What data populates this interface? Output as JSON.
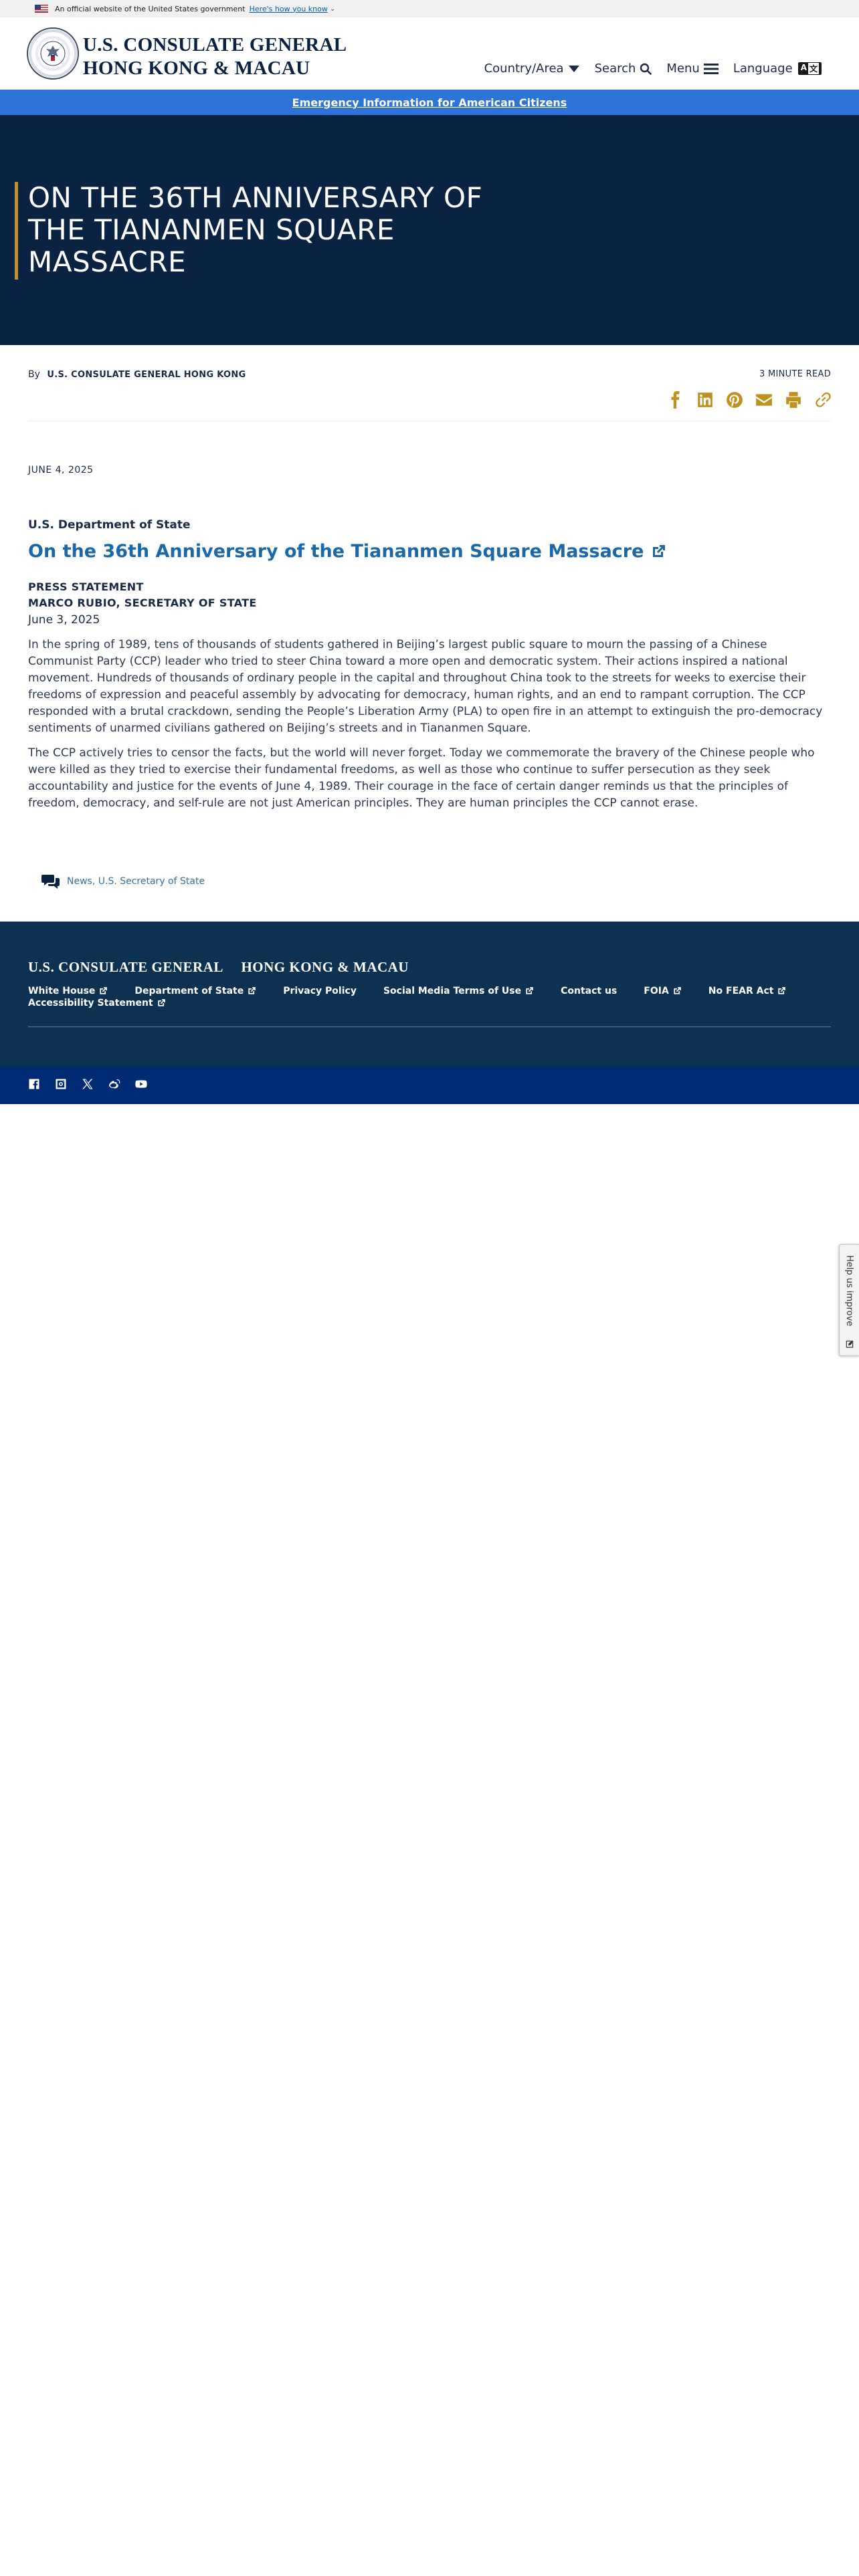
{
  "gov_banner": {
    "text": "An official website of the United States government",
    "link": "Here's how you know"
  },
  "header": {
    "brand_line1": "U.S. CONSULATE GENERAL",
    "brand_line2": "HONG KONG & MACAU",
    "nav": {
      "country": "Country/Area",
      "search": "Search",
      "menu": "Menu",
      "language": "Language",
      "lang_badge_a": "A",
      "lang_badge_b": "文"
    }
  },
  "emergency": {
    "label": "Emergency Information for American Citizens"
  },
  "hero": {
    "title": "ON THE 36TH ANNIVERSARY OF THE TIANANMEN SQUARE MASSACRE"
  },
  "meta": {
    "by": "By",
    "author": "U.S. CONSULATE GENERAL HONG KONG",
    "read_time": "3 MINUTE READ",
    "share_icons": [
      "facebook-icon",
      "linkedin-icon",
      "pinterest-icon",
      "email-icon",
      "print-icon",
      "link-icon"
    ]
  },
  "article": {
    "date": "JUNE 4, 2025",
    "department": "U.S. Department of State",
    "title": "On the 36th Anniversary of the Tiananmen Square Massacre",
    "type": "PRESS STATEMENT",
    "speaker": "MARCO RUBIO, SECRETARY OF STATE",
    "statement_date": "June 3, 2025",
    "paragraphs": [
      "In the spring of 1989, tens of thousands of students gathered in Beijing’s largest public square to mourn the passing of a Chinese Communist Party (CCP) leader who tried to steer China toward a more open and democratic system. Their actions inspired a national movement. Hundreds of thousands of ordinary people in the capital and throughout China took to the streets for weeks to exercise their freedoms of expression and peaceful assembly by advocating for democracy, human rights, and an end to rampant corruption. The CCP responded with a brutal crackdown, sending the People’s Liberation Army (PLA) to open fire in an attempt to extinguish the pro-democracy sentiments of unarmed civilians gathered on Beijing’s streets and in Tiananmen Square.",
      "The CCP actively tries to censor the facts, but the world will never forget. Today we commemorate the bravery of the Chinese people who were killed as they tried to exercise their fundamental freedoms, as well as those who continue to suffer persecution as they seek accountability and justice for the events of June 4, 1989. Their courage in the face of certain danger reminds us that the principles of freedom, democracy, and self-rule are not just American principles. They are human principles the CCP cannot erase."
    ]
  },
  "tags": {
    "tag1": "News",
    "separator": ", ",
    "tag2": "U.S. Secretary of State"
  },
  "footer": {
    "brand_line1": "U.S. CONSULATE GENERAL",
    "brand_line2": "HONG KONG & MACAU",
    "links": [
      "White House",
      "Department of State",
      "Privacy Policy",
      "Social Media Terms of Use",
      "Contact us",
      "FOIA",
      "No FEAR Act",
      "Accessibility Statement"
    ],
    "social_icons": [
      "facebook-icon",
      "instagram-icon",
      "x-icon",
      "weibo-icon",
      "youtube-icon"
    ]
  },
  "help_tab": {
    "label": "Help us improve"
  },
  "colors": {
    "navy": "#0b2343",
    "accent_gold": "#c1911f",
    "link_blue": "#1a68a8",
    "emergency_blue": "#2e74d6",
    "footer_navy": "#0d3150",
    "social_bar": "#002a73"
  }
}
